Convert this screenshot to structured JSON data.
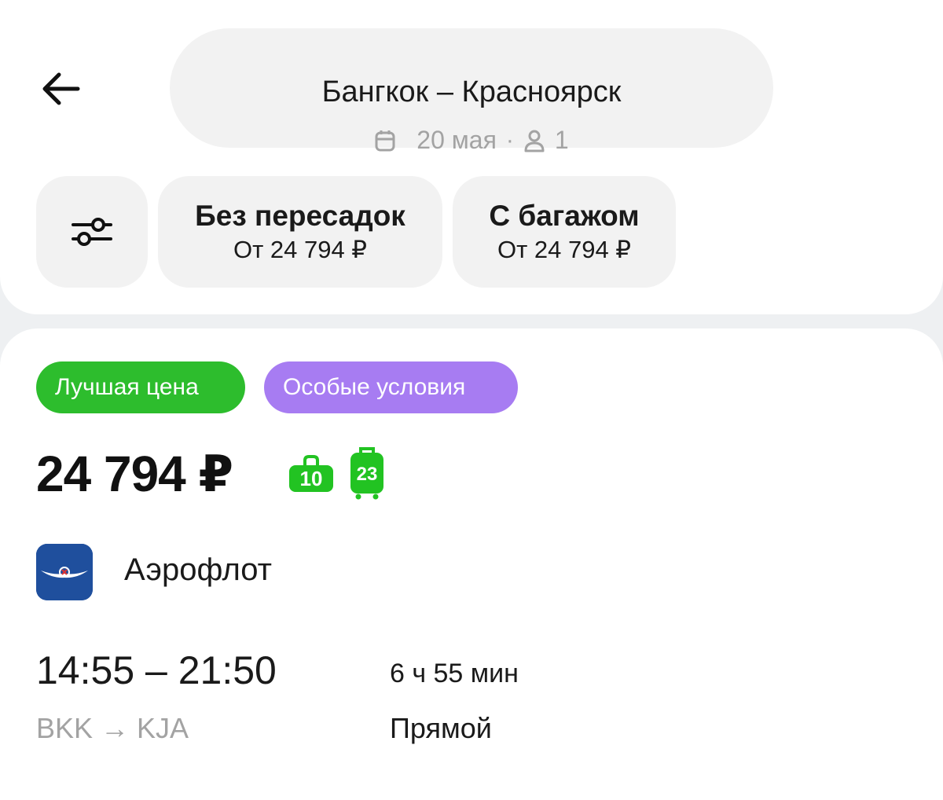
{
  "header": {
    "route_title": "Бангкок – Красноярск",
    "date": "20 мая",
    "separator": "·",
    "passengers": "1"
  },
  "filters": [
    {
      "title": "Без пересадок",
      "subtitle": "От 24 794 ₽"
    },
    {
      "title": "С багажом",
      "subtitle": "От 24 794 ₽"
    }
  ],
  "offer": {
    "badges": {
      "best": "Лучшая цена",
      "special": "Особые условия"
    },
    "price": "24 794 ₽",
    "hand_luggage_kg": "10",
    "checked_baggage_kg": "23",
    "airline": "Аэрофлот",
    "times": "14:55 – 21:50",
    "airports": "BKK → KJA",
    "duration": "6 ч 55 мин",
    "stops": "Прямой"
  },
  "colors": {
    "best_badge": "#2dbd2d",
    "special_badge": "#a77cf2",
    "baggage_icon": "#22c322",
    "airline_logo_bg": "#1f4f9d"
  },
  "icons": {
    "back": "arrow-left-icon",
    "calendar": "calendar-icon",
    "passenger": "person-icon",
    "filters": "sliders-icon",
    "hand_luggage": "hand-luggage-icon",
    "checked_baggage": "suitcase-icon"
  }
}
